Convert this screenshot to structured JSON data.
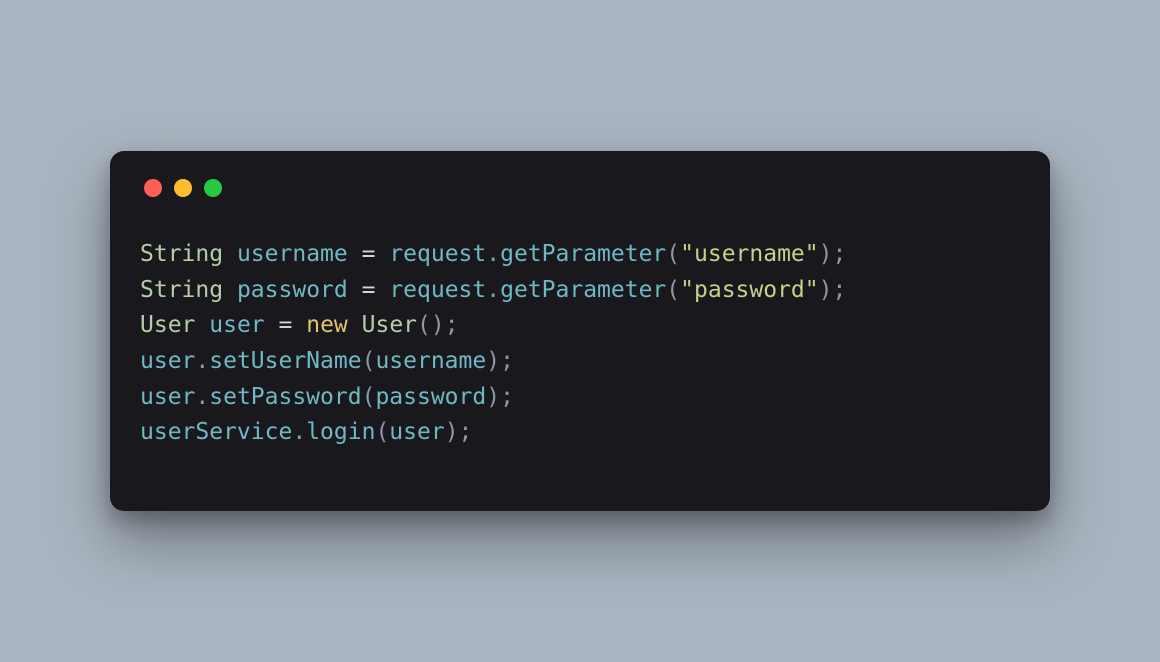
{
  "window": {
    "traffic_lights": {
      "close_color": "#ff5f56",
      "minimize_color": "#ffbd2e",
      "zoom_color": "#27c93f"
    }
  },
  "code": {
    "lines": [
      {
        "type": "String",
        "var": "username",
        "eq": "=",
        "obj": "request",
        "dot": ".",
        "method": "getParameter",
        "open": "(",
        "str_q1": "\"",
        "str_body": "username",
        "str_q2": "\"",
        "close": ")",
        "semi": ";"
      },
      {
        "type": "String",
        "var": "password",
        "eq": "=",
        "obj": "request",
        "dot": ".",
        "method": "getParameter",
        "open": "(",
        "str_q1": "\"",
        "str_body": "password",
        "str_q2": "\"",
        "close": ")",
        "semi": ";"
      },
      {
        "type": "User",
        "var": "user",
        "eq": "=",
        "keyword": "new",
        "ctor": "User",
        "open": "(",
        "close": ")",
        "semi": ";"
      },
      {
        "obj": "user",
        "dot": ".",
        "method": "setUserName",
        "open": "(",
        "arg": "username",
        "close": ")",
        "semi": ";"
      },
      {
        "obj": "user",
        "dot": ".",
        "method": "setPassword",
        "open": "(",
        "arg": "password",
        "close": ")",
        "semi": ";"
      },
      {
        "obj": "userService",
        "dot": ".",
        "method": "login",
        "open": "(",
        "arg": "user",
        "close": ")",
        "semi": ";"
      }
    ]
  }
}
